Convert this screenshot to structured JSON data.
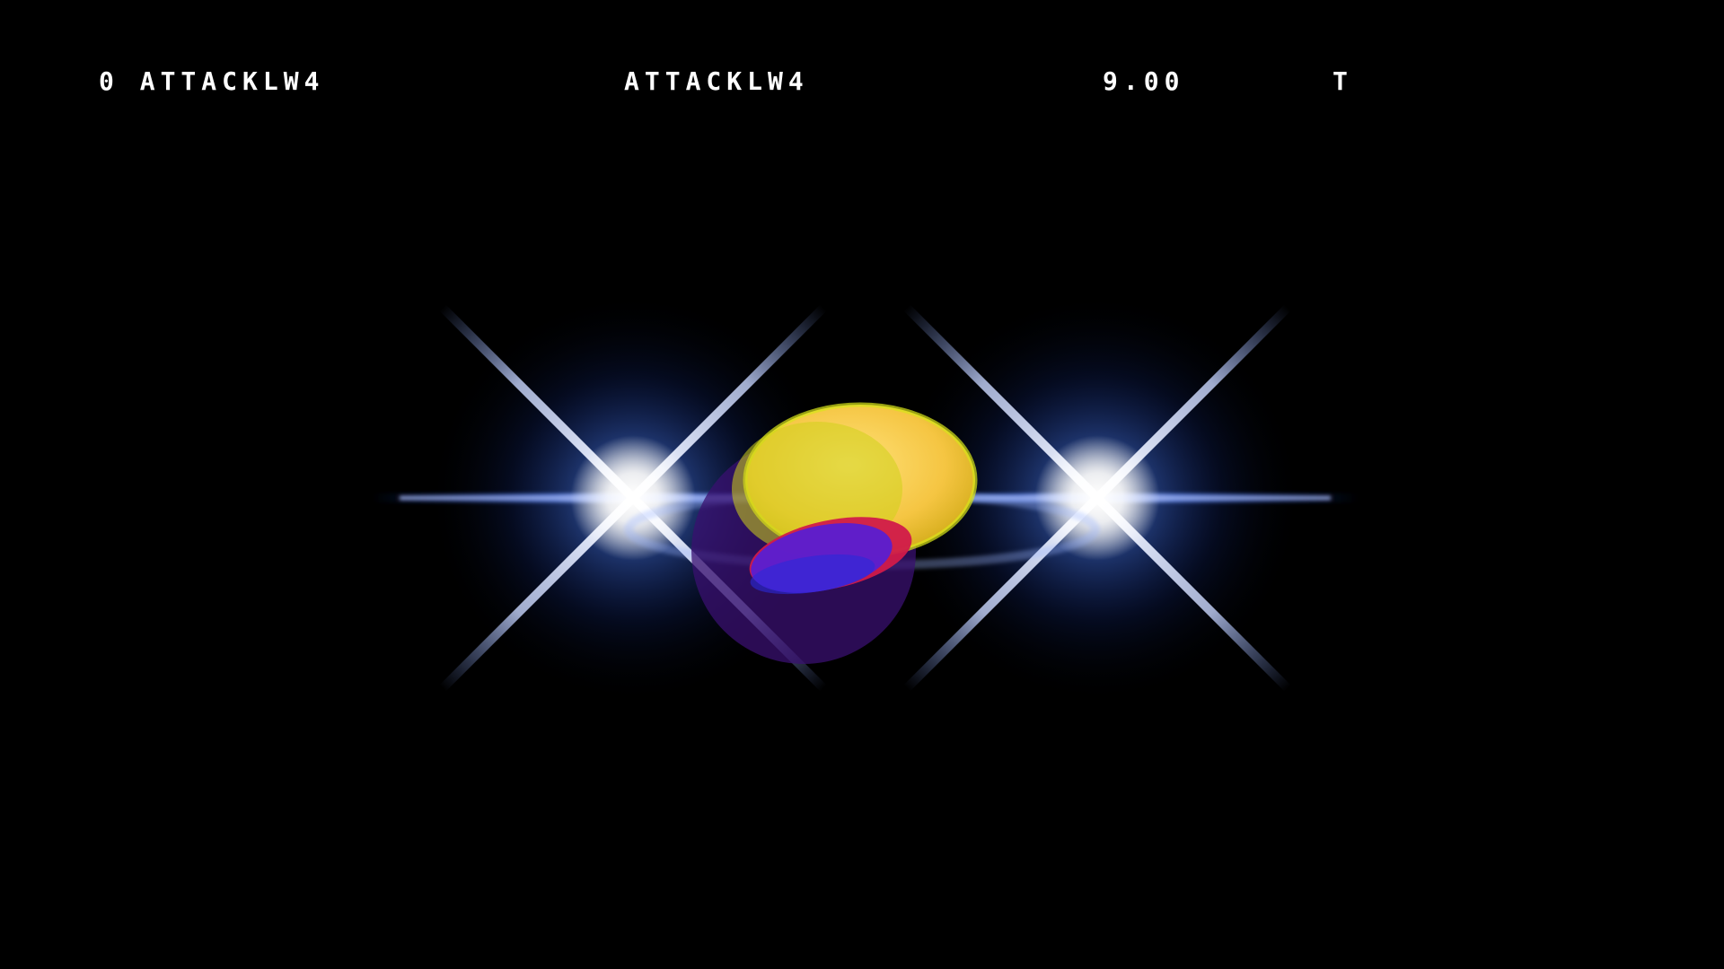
{
  "hud": {
    "frame_action": "0 ATTACKLW4",
    "action_name": "ATTACKLW4",
    "frame_value": "9.00",
    "flag": "T"
  },
  "scene": {
    "background_color": "#000000",
    "flare_core_color": "#ffffff",
    "flare_glow_color": "#1f4fd8",
    "hitbox_colors": {
      "yellow": "#f5c542",
      "lime": "#d9e61a",
      "purple": "#5a1fd1",
      "blue": "#2a2ad8",
      "red": "#d11a4a",
      "dark_violet": "#3a1070"
    },
    "icons": [
      "left-star-flare-icon",
      "right-star-flare-icon"
    ]
  }
}
